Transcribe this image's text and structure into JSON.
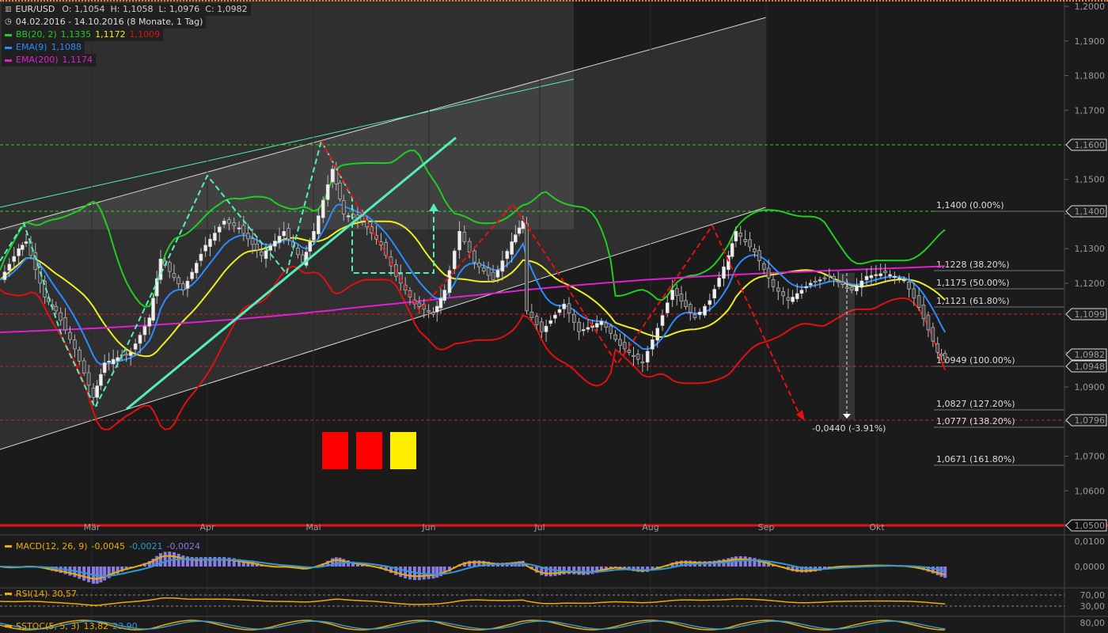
{
  "header": {
    "symbol": "EUR/USD",
    "ohlc": "O: 1,1054  H: 1,1058  L: 1,0976  C: 1,0982",
    "range": "04.02.2016 - 14.10.2016 (8 Monate, 1 Tag)",
    "bb_label": "BB(20, 2)",
    "bb_mid": "1,1335",
    "bb_upper": "1,1172",
    "bb_lower": "1,1009",
    "ema9_label": "EMA(9)",
    "ema9_value": "1,1088",
    "ema200_label": "EMA(200)",
    "ema200_value": "1,1174"
  },
  "colors": {
    "bb": "#22cc22",
    "ema9": "#2a8cff",
    "ema200": "#e020d0",
    "bb_lower": "#e01010",
    "bb_upper": "#eeee22",
    "annotation": "#55eebb",
    "accent_red": "#e81010"
  },
  "chart_data": {
    "type": "candlestick",
    "symbol": "EUR/USD",
    "x_labels": [
      "Mär",
      "Apr",
      "Mai",
      "Jun",
      "Jul",
      "Aug",
      "Sep",
      "Okt"
    ],
    "y_ticks": [
      "1,2000",
      "1,1900",
      "1,1800",
      "1,1700",
      "1,1600",
      "1,1500",
      "1,1400",
      "1,1300",
      "1,1200",
      "1,1000",
      "1,0900",
      "1,0800",
      "1,0700",
      "1,0600",
      "1,0500"
    ],
    "ylim": [
      1.05,
      1.2
    ],
    "price_tags": [
      "1,1600",
      "1,1400",
      "1,1099",
      "1,0982",
      "1,0948",
      "1,0796",
      "1,0500"
    ],
    "fib_levels": [
      {
        "label": "1,1400 (0.00%)",
        "value": 1.14
      },
      {
        "label": "1,1228 (38.20%)",
        "value": 1.1228
      },
      {
        "label": "1,1175 (50.00%)",
        "value": 1.1175
      },
      {
        "label": "1,1121 (61.80%)",
        "value": 1.1121
      },
      {
        "label": "1,0949 (100.00%)",
        "value": 1.0949
      },
      {
        "label": "1,0827 (127.20%)",
        "value": 1.0827
      },
      {
        "label": "1,0777 (138.20%)",
        "value": 1.0777
      },
      {
        "label": "1,0671 (161.80%)",
        "value": 1.0671
      }
    ],
    "measure_label": "-0,0440 (-3.91%)",
    "close_path": [
      [
        "2016-02-04",
        1.121
      ],
      [
        "2016-02-09",
        1.13
      ],
      [
        "2016-02-11",
        1.132
      ],
      [
        "2016-02-16",
        1.116
      ],
      [
        "2016-02-19",
        1.112
      ],
      [
        "2016-02-24",
        1.101
      ],
      [
        "2016-02-29",
        1.087
      ],
      [
        "2016-03-03",
        1.097
      ],
      [
        "2016-03-10",
        1.1
      ],
      [
        "2016-03-15",
        1.11
      ],
      [
        "2016-03-18",
        1.127
      ],
      [
        "2016-03-24",
        1.118
      ],
      [
        "2016-03-30",
        1.131
      ],
      [
        "2016-04-04",
        1.138
      ],
      [
        "2016-04-08",
        1.136
      ],
      [
        "2016-04-14",
        1.128
      ],
      [
        "2016-04-20",
        1.135
      ],
      [
        "2016-04-25",
        1.126
      ],
      [
        "2016-04-28",
        1.135
      ],
      [
        "2016-05-03",
        1.153
      ],
      [
        "2016-05-06",
        1.14
      ],
      [
        "2016-05-11",
        1.138
      ],
      [
        "2016-05-16",
        1.131
      ],
      [
        "2016-05-20",
        1.122
      ],
      [
        "2016-05-25",
        1.114
      ],
      [
        "2016-05-30",
        1.111
      ],
      [
        "2016-06-02",
        1.118
      ],
      [
        "2016-06-06",
        1.135
      ],
      [
        "2016-06-10",
        1.126
      ],
      [
        "2016-06-15",
        1.121
      ],
      [
        "2016-06-20",
        1.132
      ],
      [
        "2016-06-23",
        1.138
      ],
      [
        "2016-06-24",
        1.112
      ],
      [
        "2016-06-28",
        1.106
      ],
      [
        "2016-07-04",
        1.114
      ],
      [
        "2016-07-08",
        1.106
      ],
      [
        "2016-07-14",
        1.109
      ],
      [
        "2016-07-19",
        1.102
      ],
      [
        "2016-07-25",
        1.097
      ],
      [
        "2016-07-29",
        1.107
      ],
      [
        "2016-08-02",
        1.118
      ],
      [
        "2016-08-08",
        1.11
      ],
      [
        "2016-08-12",
        1.115
      ],
      [
        "2016-08-17",
        1.128
      ],
      [
        "2016-08-19",
        1.135
      ],
      [
        "2016-08-24",
        1.129
      ],
      [
        "2016-08-29",
        1.119
      ],
      [
        "2016-09-02",
        1.115
      ],
      [
        "2016-09-08",
        1.12
      ],
      [
        "2016-09-13",
        1.122
      ],
      [
        "2016-09-19",
        1.118
      ],
      [
        "2016-09-23",
        1.122
      ],
      [
        "2016-09-28",
        1.123
      ],
      [
        "2016-10-03",
        1.121
      ],
      [
        "2016-10-07",
        1.113
      ],
      [
        "2016-10-12",
        1.1
      ],
      [
        "2016-10-14",
        1.098
      ]
    ]
  },
  "sub_panels": {
    "macd": {
      "label": "MACD(12, 26, 9)",
      "v1": "-0,0045",
      "v2": "-0,0021",
      "v3": "-0,0024",
      "ticks": [
        "0,0100",
        "0,0000"
      ]
    },
    "rsi": {
      "label": "RSI(14)",
      "value": "30,57",
      "ticks": [
        "70,00",
        "30,00"
      ]
    },
    "sstoc": {
      "label": "SSTOC(5, 5, 3)",
      "v1": "13,82",
      "v2": "23,90",
      "ticks": [
        "80,00"
      ]
    }
  }
}
